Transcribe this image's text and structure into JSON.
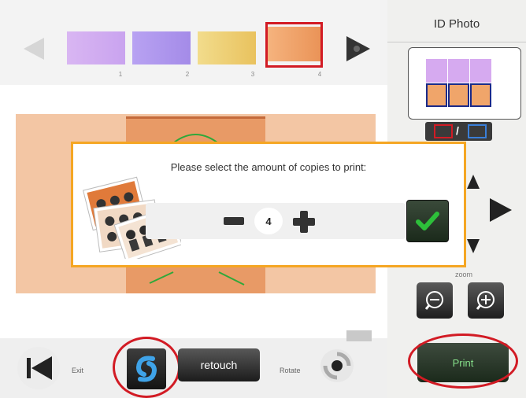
{
  "thumbnails": {
    "items": [
      {
        "number": "1",
        "color": "#d8b3f0"
      },
      {
        "number": "2",
        "color": "#b49cf0"
      },
      {
        "number": "3",
        "color": "#efd27a"
      },
      {
        "number": "4",
        "color": "#f0a56a"
      }
    ],
    "selected_number": "4"
  },
  "sidebar": {
    "title": "ID Photo",
    "color_toggle_separator": "/",
    "zoom_label": "zoom",
    "print_label": "Print"
  },
  "dialog": {
    "prompt": "Please select the amount of copies to print:",
    "quantity": "4"
  },
  "toolbar": {
    "exit_label": "Exit",
    "retouch_label": "retouch",
    "rotate_label": "Rotate"
  },
  "colors": {
    "accent_red": "#d21b24",
    "dialog_border": "#f5a623",
    "confirm_check": "#2dbf3a"
  }
}
